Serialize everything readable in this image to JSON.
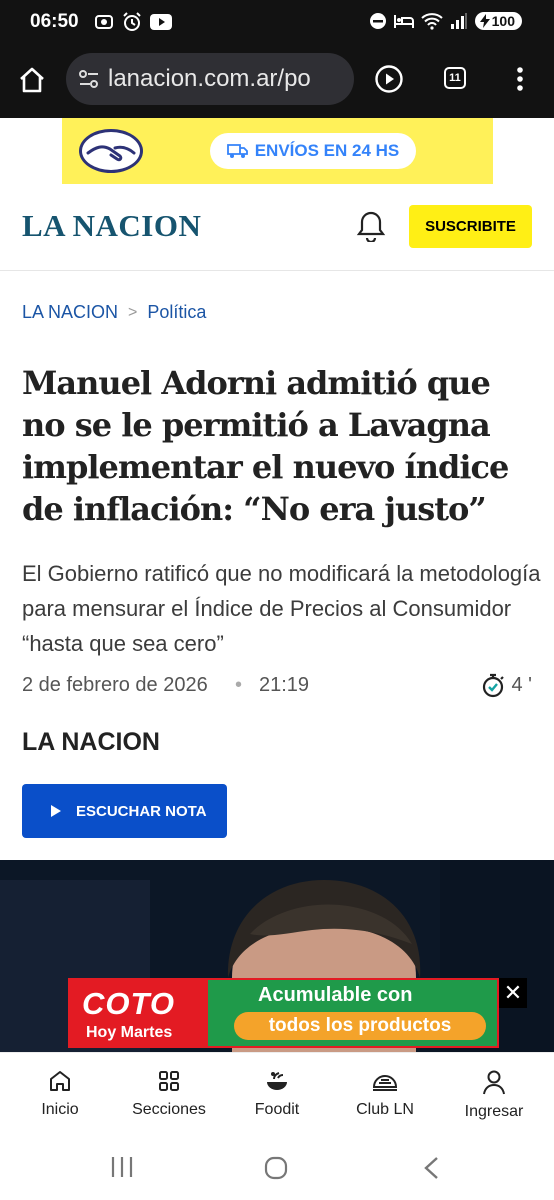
{
  "status_bar": {
    "time": "06:50",
    "battery": "100"
  },
  "browser": {
    "url": "lanacion.com.ar/po",
    "tab_count": "11"
  },
  "ad_top": {
    "text": "ENVÍOS EN 24 HS"
  },
  "header": {
    "logo": "LA NACION",
    "subscribe_label": "SUSCRIBITE"
  },
  "breadcrumb": {
    "home": "LA NACION",
    "separator": ">",
    "section": "Política"
  },
  "article": {
    "headline": "Manuel Adorni admitió que no se le permitió a Lavagna implementar el nuevo índice de inflación: “No era justo”",
    "subtitle": "El Gobierno ratificó que no modificará la metodología para mensurar el Índice de Precios al Consumidor “hasta que sea cero”",
    "date": "2 de febrero de 2026",
    "dot": "•",
    "time": "21:19",
    "read_time": "4 '",
    "author": "LA NACION",
    "listen_label": "ESCUCHAR NOTA"
  },
  "ad_bottom": {
    "brand": "COTO",
    "sub": "Hoy Martes",
    "headline": "Acumulable con",
    "pill": "todos los productos",
    "close": "✕"
  },
  "bottom_nav": {
    "items": [
      {
        "label": "Inicio",
        "icon": "home-icon"
      },
      {
        "label": "Secciones",
        "icon": "grid-icon"
      },
      {
        "label": "Foodit",
        "icon": "foodit-icon"
      },
      {
        "label": "Club LN",
        "icon": "club-icon"
      },
      {
        "label": "Ingresar",
        "icon": "user-icon"
      }
    ]
  },
  "colors": {
    "brand_blue": "#16546f",
    "link_blue": "#1b55a5",
    "listen_blue": "#0a4fc9",
    "subscribe_yellow": "#ffef15",
    "ml_yellow": "#fff159",
    "coto_red": "#e31b23",
    "coto_green": "#1f9a4a"
  }
}
